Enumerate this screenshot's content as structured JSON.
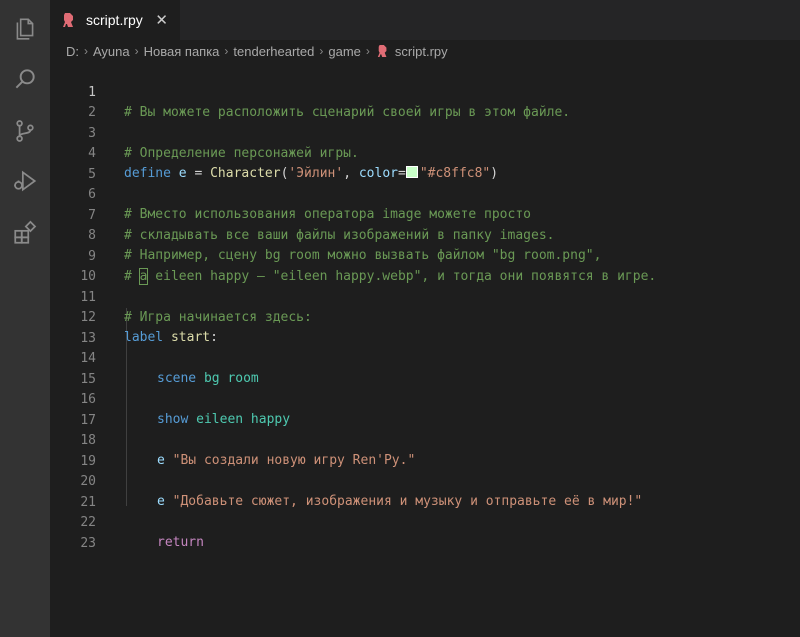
{
  "activity_bar": {
    "icons": [
      "files-icon",
      "search-icon",
      "source-control-icon",
      "run-debug-icon",
      "extensions-icon"
    ]
  },
  "tab": {
    "label": "script.rpy",
    "close": "✕"
  },
  "breadcrumb": {
    "items": [
      "D:",
      "Ayuna",
      "Новая папка",
      "tenderhearted",
      "game"
    ],
    "file": "script.rpy"
  },
  "colors": {
    "comment": "#6a9955",
    "keyword": "#569cd6",
    "string": "#ce9178",
    "function": "#dcdcaa",
    "swatch": "#c8ffc8"
  },
  "editor": {
    "line_numbers": [
      "1",
      "2",
      "3",
      "4",
      "5",
      "6",
      "7",
      "8",
      "9",
      "10",
      "11",
      "12",
      "13",
      "14",
      "15",
      "16",
      "17",
      "18",
      "19",
      "20",
      "21",
      "22",
      "23"
    ],
    "lines": {
      "l1": "# Вы можете расположить сценарий своей игры в этом файле.",
      "l3": "# Определение персонажей игры.",
      "l4_define": "define",
      "l4_var": "e",
      "l4_eq": " = ",
      "l4_fn": "Character",
      "l4_open": "(",
      "l4_name": "'Эйлин'",
      "l4_comma": ", ",
      "l4_kwarg": "color",
      "l4_eq2": "=",
      "l4_color": "\"#c8ffc8\"",
      "l4_close": ")",
      "l6": "# Вместо использования оператора image можете просто",
      "l7": "# складывать все ваши файлы изображений в папку images.",
      "l8": "# Например, сцену bg room можно вызвать файлом \"bg room.png\",",
      "l9_pre": "# ",
      "l9_cursor": "а",
      "l9_post": " eileen happy — \"eileen happy.webp\", и тогда они появятся в игре.",
      "l11": "# Игра начинается здесь:",
      "l12_kw": "label",
      "l12_name": "start",
      "l12_colon": ":",
      "l14_kw": "scene",
      "l14_arg": "bg room",
      "l16_kw": "show",
      "l16_arg": "eileen happy",
      "l18_who": "e",
      "l18_str": "\"Вы создали новую игру Ren'Py.\"",
      "l20_who": "e",
      "l20_str": "\"Добавьте сюжет, изображения и музыку и отправьте её в мир!\"",
      "l22_kw": "return"
    }
  }
}
